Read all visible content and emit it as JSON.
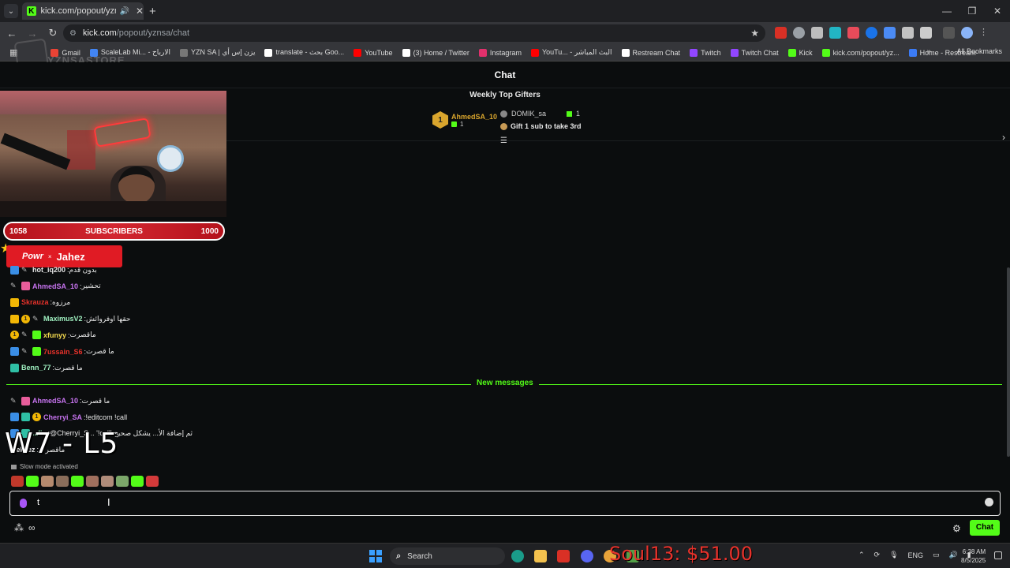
{
  "browser": {
    "tab_title": "kick.com/popout/yznsa/chat",
    "url_host": "kick.com",
    "url_path": "/popout/yznsa/chat",
    "bookmarks": [
      {
        "label": "Gmail",
        "color": "#ea4335"
      },
      {
        "label": "ScaleLab Mi... - الارباح",
        "color": "#4285f4"
      },
      {
        "label": "YZN SA | يزن إس أي",
        "color": "#777777"
      },
      {
        "label": "translate - بحث Goo...",
        "color": "#ffffff"
      },
      {
        "label": "YouTube",
        "color": "#ff0000"
      },
      {
        "label": "(3) Home / Twitter",
        "color": "#ffffff"
      },
      {
        "label": "Instagram",
        "color": "#e1306c"
      },
      {
        "label": "YouTu... - البث المباشر",
        "color": "#ff0000"
      },
      {
        "label": "Restream Chat",
        "color": "#ffffff"
      },
      {
        "label": "Twitch",
        "color": "#9146ff"
      },
      {
        "label": "Twitch Chat",
        "color": "#9146ff"
      },
      {
        "label": "Kick",
        "color": "#53fc18"
      },
      {
        "label": "kick.com/popout/yz...",
        "color": "#53fc18"
      },
      {
        "label": "Home - Restream",
        "color": "#3b7bf6"
      }
    ],
    "all_bookmarks": "All Bookmarks",
    "watermark": "YZNSASTORE"
  },
  "chat": {
    "header": "Chat",
    "top_gifters_title": "Weekly Top Gifters",
    "gifter1": {
      "rank": "1",
      "name": "AhmedSA_10",
      "count": "1"
    },
    "gifter2": {
      "name": "DOMIK_sa",
      "count": "1",
      "cta": "Gift 1 sub to take 3rd"
    },
    "subs": {
      "current": "1058",
      "label": "SUBSCRIBERS",
      "goal": "1000"
    },
    "sponsor": {
      "brand1": "Powr",
      "x": "×",
      "brand2": "Jahez"
    },
    "messages": [
      {
        "user": "hot_iq200",
        "color": "#e8e8e8",
        "text": "بدون قدم",
        "badges": [
          "vip",
          "pen"
        ]
      },
      {
        "user": "AhmedSA_10",
        "color": "#c774f0",
        "text": "تحشير",
        "badges": [
          "pen",
          "sub"
        ]
      },
      {
        "user": "Skrauza",
        "color": "#e8322b",
        "text": "مرزوه",
        "badges": [
          "crown"
        ]
      },
      {
        "user": "MaximusV2",
        "color": "#9ff0c0",
        "text": "حقها اوفروائش",
        "badges": [
          "crown",
          "gift",
          "pen"
        ]
      },
      {
        "user": "xfunyy",
        "color": "#f2d94e",
        "text": "ماقصرت",
        "badges": [
          "gift",
          "pen",
          "green"
        ]
      },
      {
        "user": "7ussain_S6",
        "color": "#e8322b",
        "text": "ما قصرت",
        "badges": [
          "vip",
          "pen",
          "green"
        ]
      },
      {
        "user": "Benn_77",
        "color": "#9ff0c0",
        "text": "ما قصرت",
        "badges": [
          "og"
        ]
      }
    ],
    "new_messages_label": "New messages",
    "new_messages": [
      {
        "user": "AhmedSA_10",
        "color": "#c774f0",
        "text": "ما قصرت",
        "badges": [
          "pen",
          "sub"
        ]
      },
      {
        "user": "Cherryi_SA",
        "color": "#c774f0",
        "text": "!editcom !call",
        "badges": [
          "vip",
          "og",
          "gift"
        ]
      },
      {
        "user": "...lix",
        "color": "#9ff0c0",
        "text": "@Cherryi_S... '!call' ثم إضافة الأ... يشكل صحيح",
        "badges": [
          "vip",
          "og"
        ]
      },
      {
        "user": "...ekzez",
        "color": "#e8e8e8",
        "text": "ماقصرت",
        "badges": []
      }
    ],
    "score_overlay": "W7 - L5",
    "slow_mode": "Slow mode activated",
    "input_value": "t",
    "send_label": "Chat"
  },
  "taskbar": {
    "search_placeholder": "Search",
    "donation": "Soul13: $51.00",
    "lang": "ENG",
    "time": "6:38 AM",
    "date": "8/5/2025"
  }
}
